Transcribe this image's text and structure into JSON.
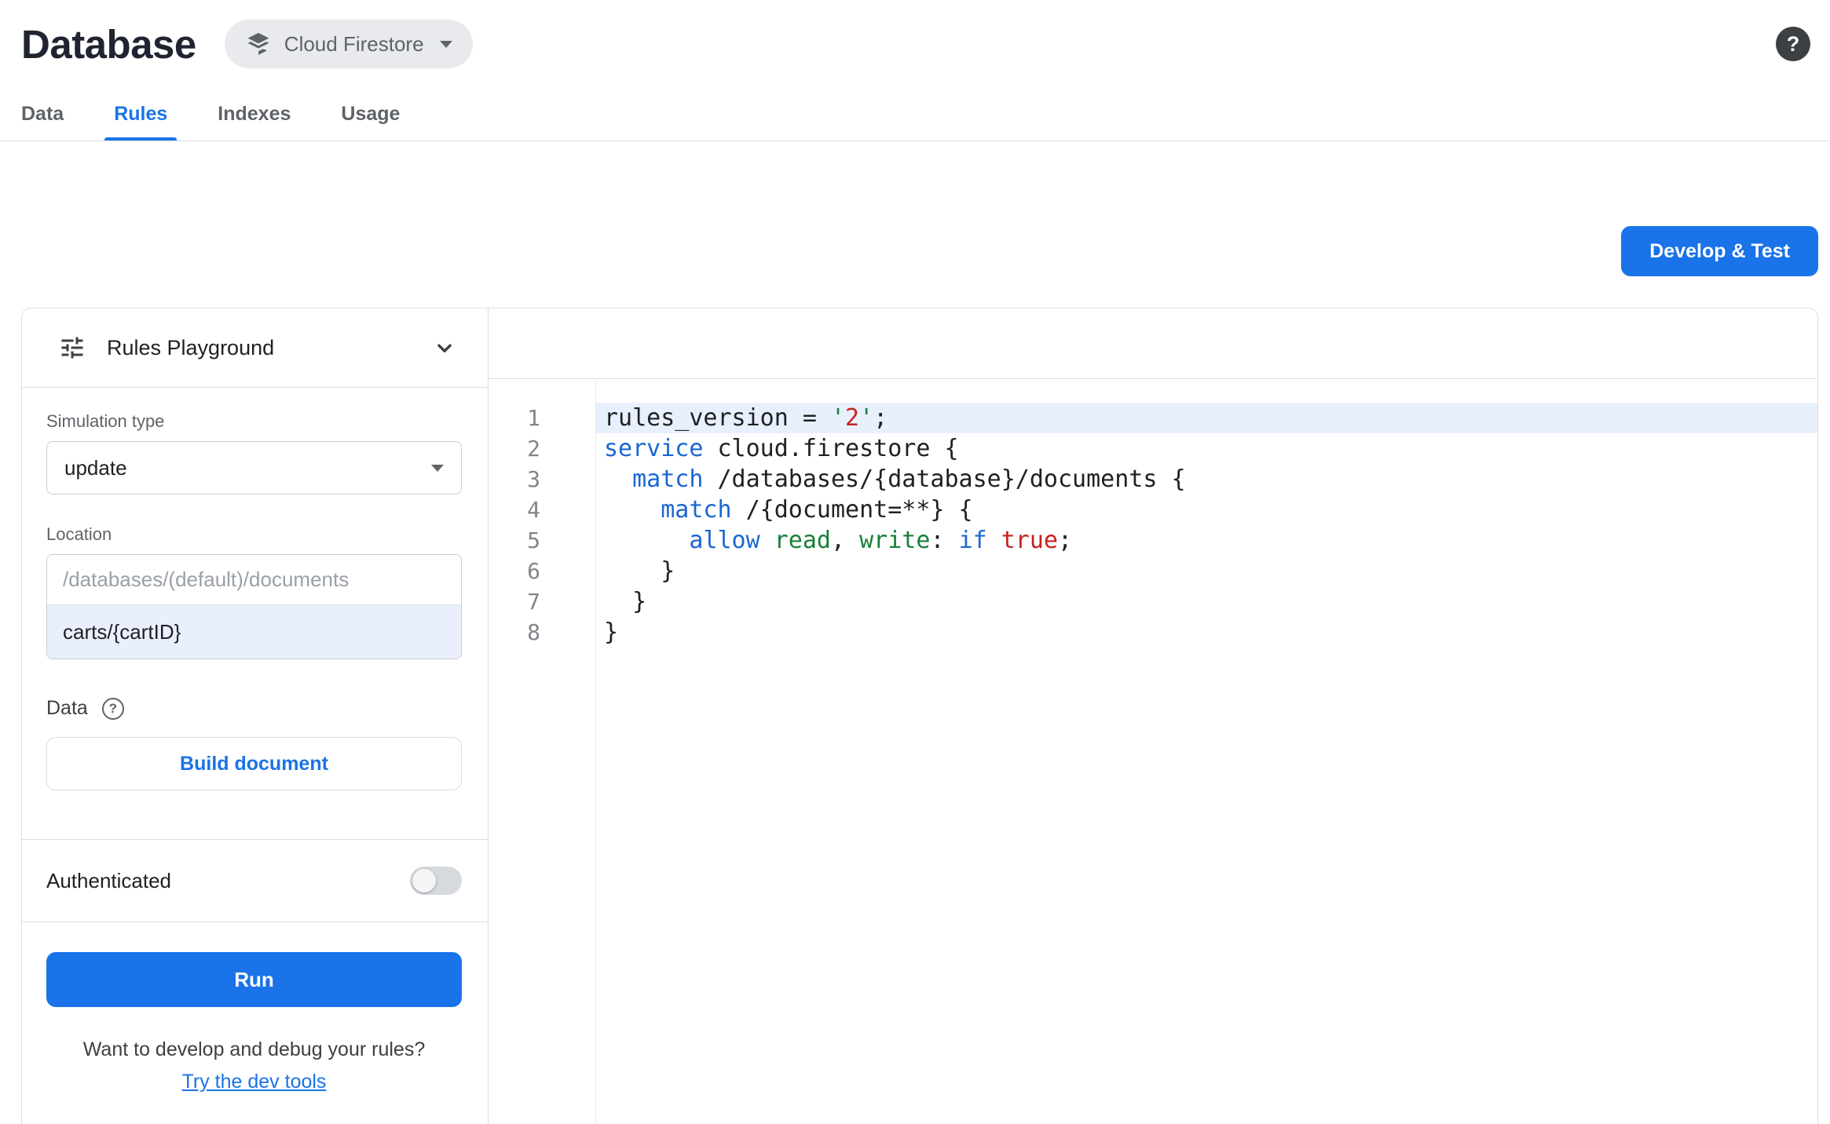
{
  "header": {
    "title": "Database",
    "product": "Cloud Firestore",
    "help_glyph": "?"
  },
  "tabs": [
    {
      "label": "Data"
    },
    {
      "label": "Rules"
    },
    {
      "label": "Indexes"
    },
    {
      "label": "Usage"
    }
  ],
  "active_tab": "Rules",
  "toolbar": {
    "develop_test_label": "Develop & Test"
  },
  "playground": {
    "title": "Rules Playground",
    "simulation_type": {
      "label": "Simulation type",
      "value": "update"
    },
    "location": {
      "label": "Location",
      "placeholder": "/databases/(default)/documents",
      "value": "carts/{cartID}"
    },
    "data_section": {
      "label": "Data",
      "help_glyph": "?",
      "build_button": "Build document"
    },
    "auth": {
      "label": "Authenticated",
      "enabled": false
    },
    "run_button": "Run",
    "dev_tools": {
      "hint": "Want to develop and debug your rules?",
      "link": "Try the dev tools"
    }
  },
  "editor": {
    "active_line": 1,
    "lines": [
      [
        [
          "p",
          "rules_version = "
        ],
        [
          "q",
          "'"
        ],
        [
          "a",
          "2"
        ],
        [
          "q",
          "'"
        ],
        [
          "p",
          ";"
        ]
      ],
      [
        [
          "k",
          "service"
        ],
        [
          "p",
          " cloud.firestore {"
        ]
      ],
      [
        [
          "p",
          "  "
        ],
        [
          "k",
          "match"
        ],
        [
          "p",
          " /databases/{database}/documents {"
        ]
      ],
      [
        [
          "p",
          "    "
        ],
        [
          "k",
          "match"
        ],
        [
          "p",
          " /{document=**} {"
        ]
      ],
      [
        [
          "p",
          "      "
        ],
        [
          "k",
          "allow"
        ],
        [
          "p",
          " "
        ],
        [
          "m",
          "read"
        ],
        [
          "p",
          ", "
        ],
        [
          "m",
          "write"
        ],
        [
          "p",
          ": "
        ],
        [
          "k",
          "if"
        ],
        [
          "p",
          " "
        ],
        [
          "a",
          "true"
        ],
        [
          "p",
          ";"
        ]
      ],
      [
        [
          "p",
          "    }"
        ]
      ],
      [
        [
          "p",
          "  }"
        ]
      ],
      [
        [
          "p",
          "}"
        ]
      ]
    ]
  },
  "colors": {
    "accent": "#1a73e8",
    "keyword": "#1967d2",
    "method": "#188038",
    "atom": "#c5221f",
    "string_quote": "#188038",
    "active_line_bg": "#e9f0fd"
  }
}
